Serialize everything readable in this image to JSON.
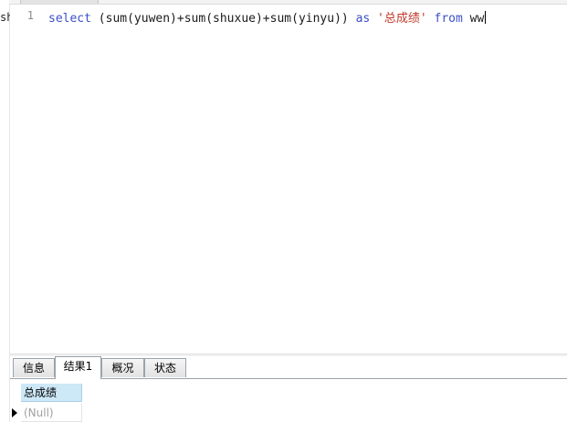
{
  "left_strip": {
    "text": "sh"
  },
  "editor": {
    "line_number": "1",
    "code": {
      "select": "select",
      "expr": " (sum(yuwen)+sum(shuxue)+sum(yinyu)) ",
      "as": "as",
      "space1": " ",
      "alias": "'总成绩'",
      "space2": " ",
      "from": "from",
      "table": " ww"
    }
  },
  "result_tabs": [
    {
      "label": "信息"
    },
    {
      "label": "结果1"
    },
    {
      "label": "概况"
    },
    {
      "label": "状态"
    }
  ],
  "active_tab": "结果1",
  "grid": {
    "columns": [
      "总成绩"
    ],
    "rows": [
      [
        "(Null)"
      ]
    ]
  },
  "colors": {
    "keyword": "#3b4ec8",
    "string": "#c0392b",
    "header_bg": "#cde8f7",
    "null_text": "#a0a0a0"
  }
}
